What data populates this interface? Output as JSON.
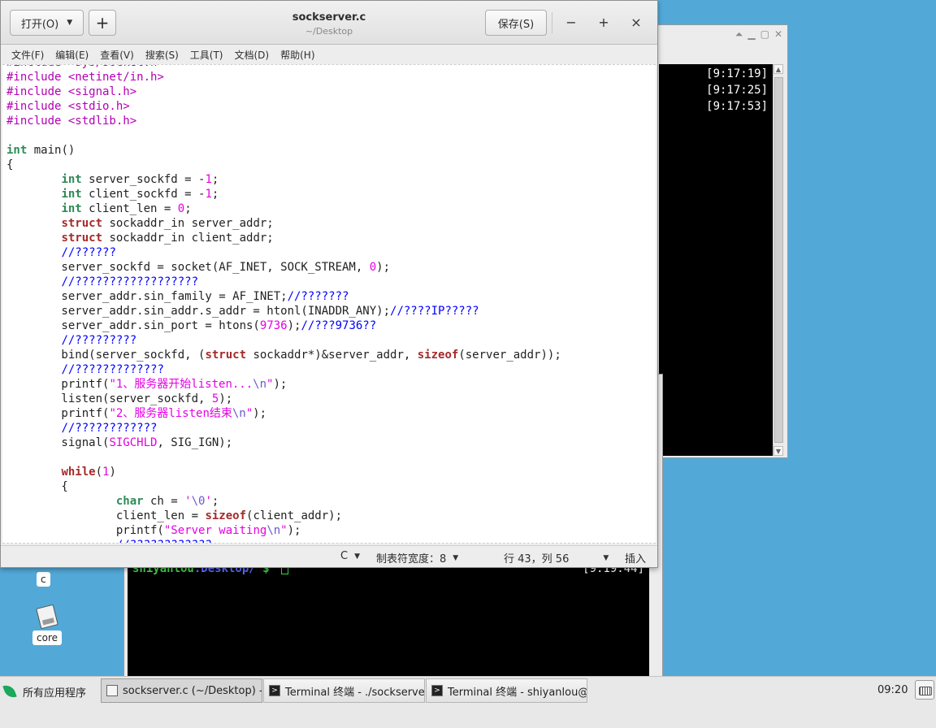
{
  "gedit": {
    "open_label": "打开(O)",
    "save_label": "保存(S)",
    "title": "sockserver.c",
    "subtitle": "~/Desktop",
    "minimize": "−",
    "maximize": "+",
    "close": "×",
    "menu": [
      "文件(F)",
      "编辑(E)",
      "查看(V)",
      "搜索(S)",
      "工具(T)",
      "文档(D)",
      "帮助(H)"
    ],
    "status": {
      "language": "C",
      "tab_width": "制表符宽度：8",
      "position": "行 43，列 56",
      "mode": "插入"
    }
  },
  "code_lines": [
    [
      [
        "pp",
        "#include <sys/socket.h>"
      ]
    ],
    [
      [
        "pp",
        "#include <netinet/in.h>"
      ]
    ],
    [
      [
        "pp",
        "#include <signal.h>"
      ]
    ],
    [
      [
        "pp",
        "#include <stdio.h>"
      ]
    ],
    [
      [
        "pp",
        "#include <stdlib.h>"
      ]
    ],
    [],
    [
      [
        "ty",
        "int"
      ],
      [
        "",
        " main()"
      ]
    ],
    [
      [
        "",
        "{"
      ]
    ],
    [
      [
        "",
        "\t"
      ],
      [
        "ty",
        "int"
      ],
      [
        "",
        " server_sockfd = -"
      ],
      [
        "nu",
        "1"
      ],
      [
        "",
        ";"
      ]
    ],
    [
      [
        "",
        "\t"
      ],
      [
        "ty",
        "int"
      ],
      [
        "",
        " client_sockfd = -"
      ],
      [
        "nu",
        "1"
      ],
      [
        "",
        ";"
      ]
    ],
    [
      [
        "",
        "\t"
      ],
      [
        "ty",
        "int"
      ],
      [
        "",
        " client_len = "
      ],
      [
        "nu",
        "0"
      ],
      [
        "",
        ";"
      ]
    ],
    [
      [
        "",
        "\t"
      ],
      [
        "kw",
        "struct"
      ],
      [
        "",
        " sockaddr_in server_addr;"
      ]
    ],
    [
      [
        "",
        "\t"
      ],
      [
        "kw",
        "struct"
      ],
      [
        "",
        " sockaddr_in client_addr;"
      ]
    ],
    [
      [
        "",
        "\t"
      ],
      [
        "cm",
        "//??????"
      ]
    ],
    [
      [
        "",
        "\tserver_sockfd = socket(AF_INET, SOCK_STREAM, "
      ],
      [
        "nu",
        "0"
      ],
      [
        "",
        ");"
      ]
    ],
    [
      [
        "",
        "\t"
      ],
      [
        "cm",
        "//??????????????????"
      ]
    ],
    [
      [
        "",
        "\tserver_addr.sin_family = AF_INET;"
      ],
      [
        "cm",
        "//???????"
      ]
    ],
    [
      [
        "",
        "\tserver_addr.sin_addr.s_addr = htonl(INADDR_ANY);"
      ],
      [
        "cm",
        "//????IP?????"
      ]
    ],
    [
      [
        "",
        "\tserver_addr.sin_port = htons("
      ],
      [
        "nu",
        "9736"
      ],
      [
        "",
        ");"
      ],
      [
        "cm",
        "//???9736??"
      ]
    ],
    [
      [
        "",
        "\t"
      ],
      [
        "cm",
        "//?????????"
      ]
    ],
    [
      [
        "",
        "\tbind(server_sockfd, ("
      ],
      [
        "kw",
        "struct"
      ],
      [
        "",
        " sockaddr*)&server_addr, "
      ],
      [
        "kw",
        "sizeof"
      ],
      [
        "",
        "(server_addr));"
      ]
    ],
    [
      [
        "",
        "\t"
      ],
      [
        "cm",
        "//?????????????"
      ]
    ],
    [
      [
        "",
        "\tprintf("
      ],
      [
        "st",
        "\"1、服务器开始listen..."
      ],
      [
        "es",
        "\\n"
      ],
      [
        "st",
        "\""
      ],
      [
        "",
        ");"
      ]
    ],
    [
      [
        "",
        "\tlisten(server_sockfd, "
      ],
      [
        "nu",
        "5"
      ],
      [
        "",
        ");"
      ]
    ],
    [
      [
        "",
        "\tprintf("
      ],
      [
        "st",
        "\"2、服务器listen结束"
      ],
      [
        "es",
        "\\n"
      ],
      [
        "st",
        "\""
      ],
      [
        "",
        ");"
      ]
    ],
    [
      [
        "",
        "\t"
      ],
      [
        "cm",
        "//????????????"
      ]
    ],
    [
      [
        "",
        "\tsignal("
      ],
      [
        "st",
        "SIGCHLD"
      ],
      [
        "",
        ", SIG_IGN);"
      ]
    ],
    [],
    [
      [
        "",
        "\t"
      ],
      [
        "kw",
        "while"
      ],
      [
        "",
        "("
      ],
      [
        "nu",
        "1"
      ],
      [
        "",
        ")"
      ]
    ],
    [
      [
        "",
        "\t{"
      ]
    ],
    [
      [
        "",
        "\t\t"
      ],
      [
        "ty",
        "char"
      ],
      [
        "",
        " ch = "
      ],
      [
        "st",
        "'"
      ],
      [
        "es",
        "\\0"
      ],
      [
        "st",
        "'"
      ],
      [
        "",
        ";"
      ]
    ],
    [
      [
        "",
        "\t\tclient_len = "
      ],
      [
        "kw",
        "sizeof"
      ],
      [
        "",
        "(client_addr);"
      ]
    ],
    [
      [
        "",
        "\t\tprintf("
      ],
      [
        "st",
        "\"Server waiting"
      ],
      [
        "es",
        "\\n"
      ],
      [
        "st",
        "\""
      ],
      [
        "",
        ");"
      ]
    ],
    [
      [
        "",
        "\t\t"
      ],
      [
        "cm",
        "//????????????"
      ]
    ]
  ],
  "terminal_right": {
    "lines": [
      "[9:17:19]",
      "[9:17:25]",
      "[9:17:53]"
    ]
  },
  "terminal_bottom": {
    "prompt_user": "shiyanlou",
    "prompt_path": ":Desktop/",
    "prompt_symbol": " $ ",
    "right_text": "[9:19:44]"
  },
  "desktop": {
    "icons": [
      {
        "label": "c",
        "name": "file-c"
      },
      {
        "label": "core",
        "name": "file-core"
      }
    ]
  },
  "taskbar": {
    "apps_label": "所有应用程序",
    "tasks": [
      {
        "label": "sockserver.c (~/Desktop) - ···",
        "active": true
      },
      {
        "label": "Terminal 终端 - ./sockserver",
        "active": false
      },
      {
        "label": "Terminal 终端 - shiyanlou@···",
        "active": false
      }
    ],
    "clock": "09:20"
  }
}
